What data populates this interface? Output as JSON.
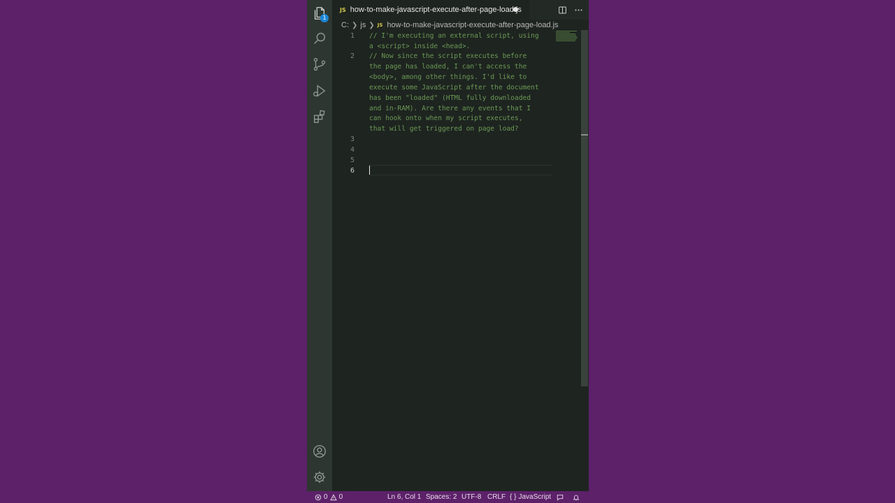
{
  "tab": {
    "lang_badge": "JS",
    "title": "how-to-make-javascript-execute-after-page-load.js"
  },
  "breadcrumb": {
    "drive": "C:",
    "folder": "js",
    "lang_badge": "JS",
    "file": "how-to-make-javascript-execute-after-page-load.js"
  },
  "activity": {
    "explorer_badge": "1"
  },
  "editor": {
    "line_numbers": [
      "1",
      "2",
      "3",
      "4",
      "5",
      "6"
    ],
    "lines": [
      "// I'm executing an external script, using",
      "a <script> inside <head>.",
      "// Now since the script executes before",
      "the page has loaded, I can't access the",
      "<body>, among other things. I'd like to",
      "execute some JavaScript after the document",
      "has been \"loaded\" (HTML fully downloaded",
      "and in-RAM). Are there any events that I",
      "can hook onto when my script executes,",
      "that will get triggered on page load?"
    ]
  },
  "status": {
    "errors": "0",
    "warnings": "0",
    "position": "Ln 6, Col 1",
    "spaces": "Spaces: 2",
    "encoding": "UTF-8",
    "eol": "CRLF",
    "language": "JavaScript"
  },
  "colors": {
    "background": "#5c2169",
    "editor": "#1e2420",
    "comment": "#6a9955",
    "js_badge": "#d6c94a"
  }
}
